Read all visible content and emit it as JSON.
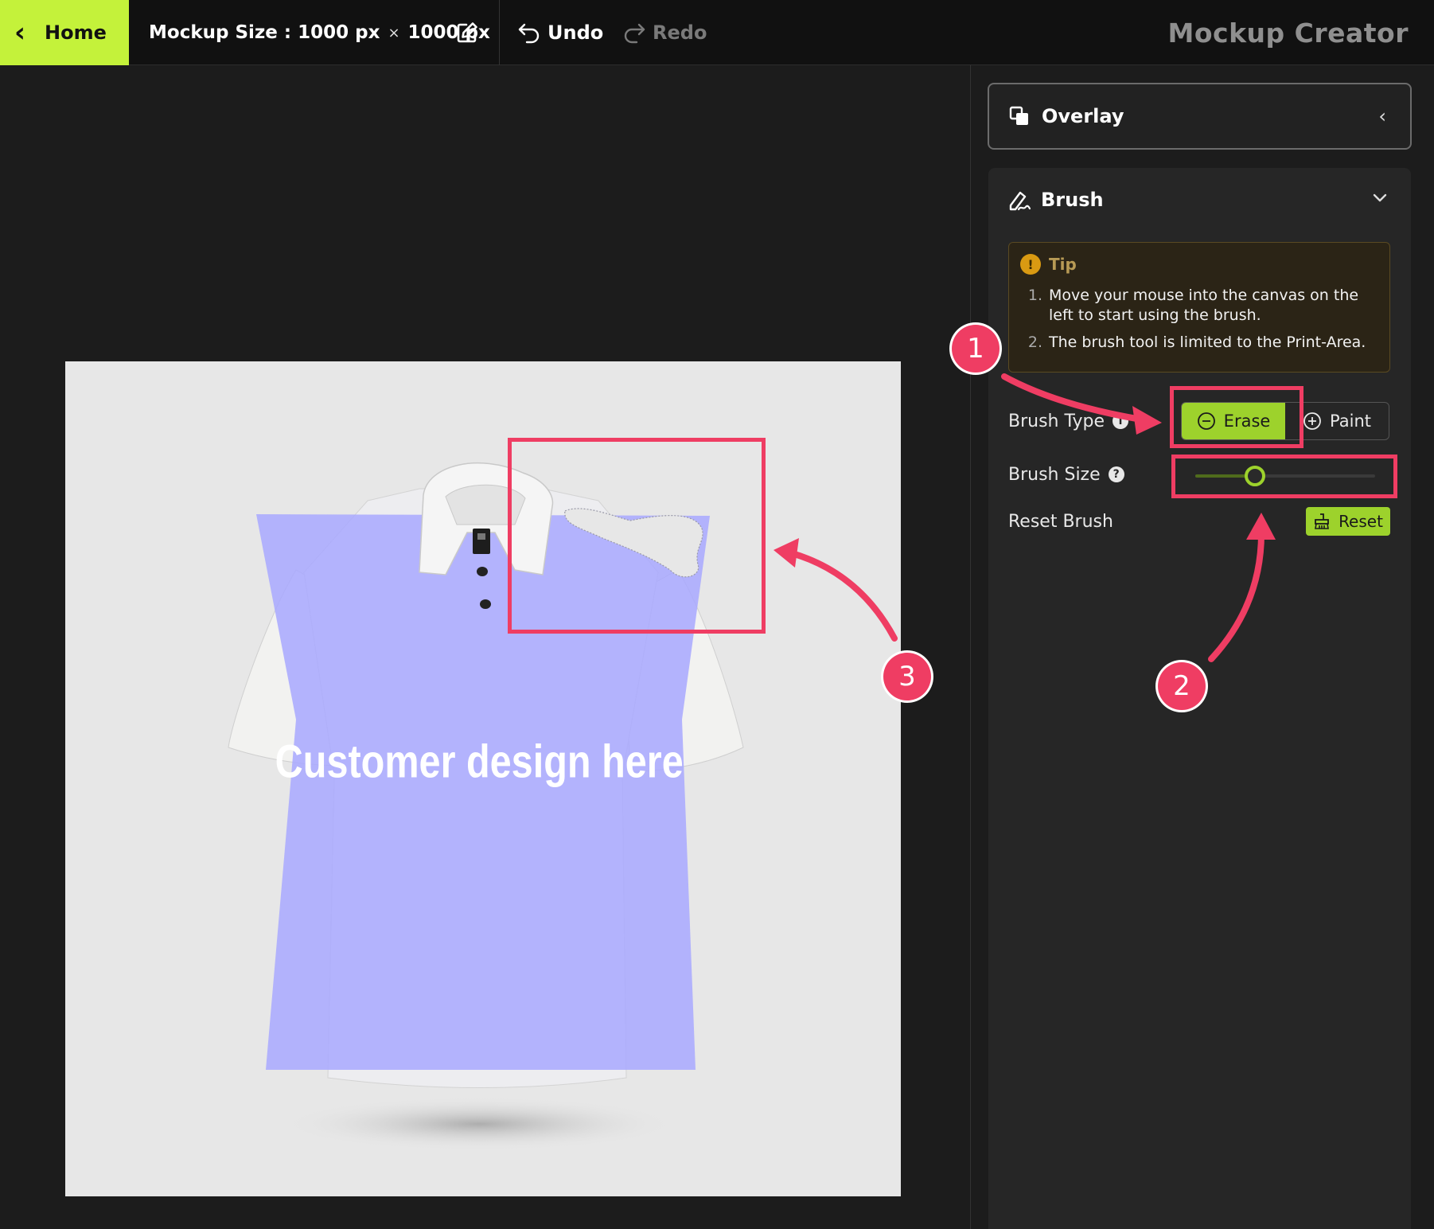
{
  "topbar": {
    "home_label": "Home",
    "mockup_size_label": "Mockup Size :",
    "width": "1000 px",
    "times": "×",
    "height": "1000 px",
    "undo_label": "Undo",
    "redo_label": "Redo",
    "app_title": "Mockup Creator"
  },
  "canvas": {
    "design_placeholder": "Customer design here"
  },
  "panel": {
    "overlay_title": "Overlay",
    "brush_title": "Brush",
    "tip": {
      "title": "Tip",
      "items": [
        {
          "num": "1.",
          "text": "Move your mouse into the canvas on the left to start using the brush."
        },
        {
          "num": "2.",
          "text": "The brush tool is limited to the Print-Area."
        }
      ]
    },
    "brush_type_label": "Brush Type",
    "brush_type_options": {
      "erase": "Erase",
      "paint": "Paint",
      "selected": "Erase"
    },
    "brush_size_label": "Brush Size",
    "brush_size_fraction": 0.33,
    "reset_brush_label": "Reset Brush",
    "reset_button_label": "Reset"
  },
  "annotations": {
    "marker_1": "1",
    "marker_2": "2",
    "marker_3": "3",
    "color": "#ef3d63"
  },
  "colors": {
    "accent": "#c4f23a",
    "accent_button": "#9dd22c",
    "print_area": "#a9a9ff"
  }
}
